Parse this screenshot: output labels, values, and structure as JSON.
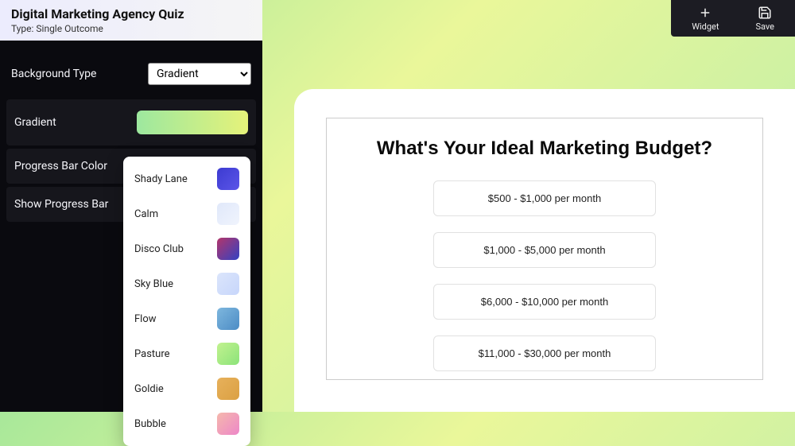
{
  "header": {
    "title": "Digital Marketing Agency Quiz",
    "subtitle": "Type: Single Outcome"
  },
  "controls": {
    "backgroundTypeLabel": "Background Type",
    "backgroundTypeValue": "Gradient",
    "gradientLabel": "Gradient",
    "progressBarColorLabel": "Progress Bar Color",
    "showProgressBarLabel": "Show Progress Bar"
  },
  "gradientOptions": [
    {
      "name": "Shady Lane",
      "cls": "shady"
    },
    {
      "name": "Calm",
      "cls": "calm"
    },
    {
      "name": "Disco Club",
      "cls": "disco"
    },
    {
      "name": "Sky Blue",
      "cls": "sky"
    },
    {
      "name": "Flow",
      "cls": "flow"
    },
    {
      "name": "Pasture",
      "cls": "pasture"
    },
    {
      "name": "Goldie",
      "cls": "goldie"
    },
    {
      "name": "Bubble",
      "cls": "bubble"
    }
  ],
  "topbar": {
    "widgetLabel": "Widget",
    "saveLabel": "Save"
  },
  "quiz": {
    "question": "What's Your Ideal Marketing Budget?",
    "answers": [
      "$500 - $1,000 per month",
      "$1,000 - $5,000 per month",
      "$6,000 - $10,000 per month",
      "$11,000 - $30,000 per month"
    ]
  }
}
